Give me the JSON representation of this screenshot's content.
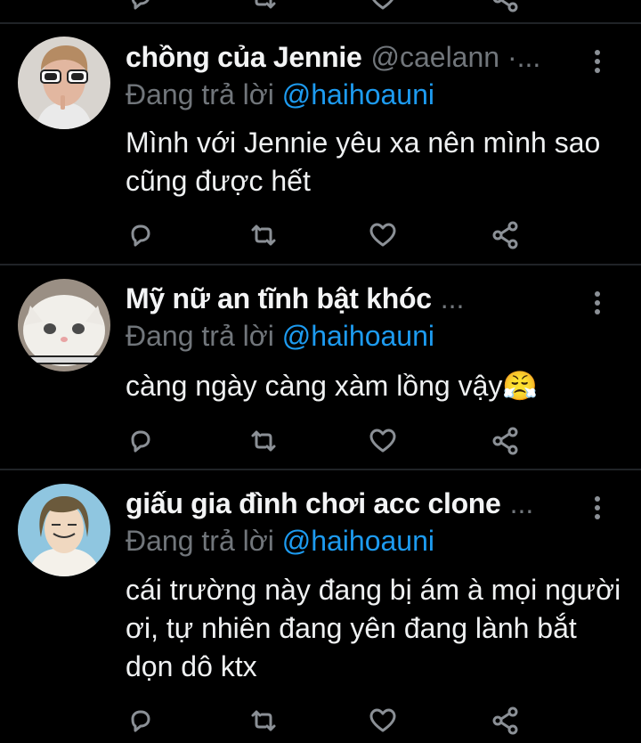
{
  "tweets": [
    {
      "name": "chồng của Jennie",
      "handle": "@caelann ·...",
      "reply_prefix": "Đang trả lời",
      "mention": "@haihoauni",
      "text": "Mình với Jennie yêu xa nên mình sao cũng được hết",
      "avatar": "person-with-white-sunglasses"
    },
    {
      "name": "Mỹ nữ an tĩnh bật khóc",
      "handle": "...",
      "reply_prefix": "Đang trả lời",
      "mention": "@haihoauni",
      "text": "càng ngày càng xàm lồng vậy",
      "emoji": "😤",
      "avatar": "white-cat"
    },
    {
      "name": "giấu gia đình chơi acc clone",
      "handle": "...",
      "reply_prefix": "Đang trả lời",
      "mention": "@haihoauni",
      "text": "cái trường này đang bị ám à mọi người ơi, tự nhiên đang yên đang lành bắt dọn dô ktx",
      "avatar": "illustrated-girl"
    }
  ],
  "icons": [
    "reply-icon",
    "retweet-icon",
    "like-icon",
    "share-icon",
    "more-options-icon"
  ],
  "colors": {
    "background": "#000000",
    "mention": "#1d9bf0",
    "muted": "#71767b",
    "divider": "#202327"
  }
}
